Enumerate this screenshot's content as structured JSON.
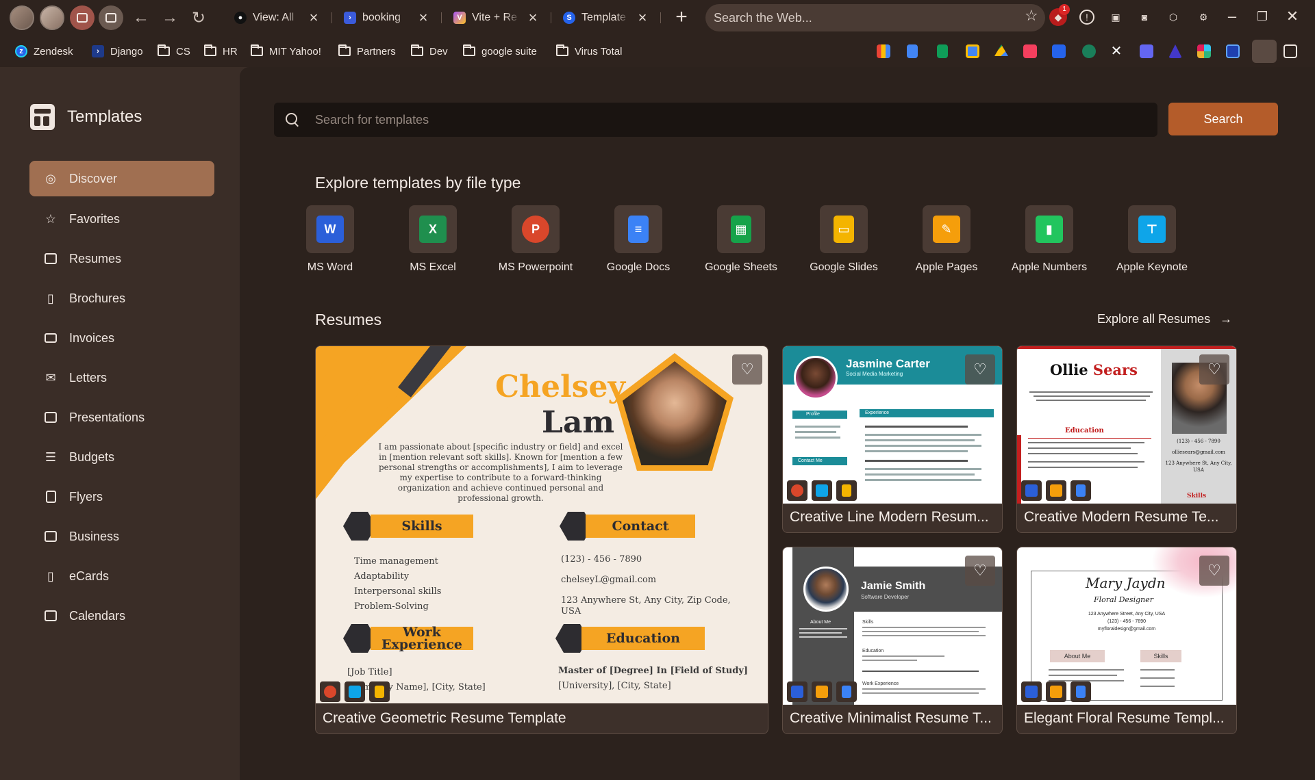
{
  "browser": {
    "tabs": [
      {
        "title": "View: All",
        "fav_color": "#111111",
        "fav_text": "●"
      },
      {
        "title": "booking",
        "fav_color": "#3b5bdb",
        "fav_text": "›"
      },
      {
        "title": "Vite + Re",
        "fav_color": "#a855f7",
        "fav_text": "V"
      },
      {
        "title": "Template",
        "fav_color": "#2563eb",
        "fav_text": "S"
      }
    ],
    "address_placeholder": "Search the Web...",
    "notification_count": "1",
    "bookmarks": [
      {
        "label": "Zendesk",
        "type": "logo",
        "color": "#2563eb"
      },
      {
        "label": "Django",
        "type": "logo",
        "color": "#1e3a8a"
      },
      {
        "label": "CS",
        "type": "folder"
      },
      {
        "label": "HR",
        "type": "folder"
      },
      {
        "label": "MIT Yahoo!",
        "type": "folder"
      },
      {
        "label": "Partners",
        "type": "folder"
      },
      {
        "label": "Dev",
        "type": "folder"
      },
      {
        "label": "google suite",
        "type": "folder"
      },
      {
        "label": "Virus Total",
        "type": "folder"
      }
    ],
    "bookmark_apps": [
      "gmail",
      "docs",
      "sheets",
      "calendar",
      "drive",
      "monday",
      "jira",
      "chatgpt",
      "x",
      "zoom",
      "linear",
      "slack",
      "meet",
      "templates",
      "grid"
    ]
  },
  "sidebar": {
    "title": "Templates",
    "items": [
      {
        "label": "Discover",
        "icon": "compass-icon",
        "active": true
      },
      {
        "label": "Favorites",
        "icon": "star-icon"
      },
      {
        "label": "Resumes",
        "icon": "id-card-icon"
      },
      {
        "label": "Brochures",
        "icon": "book-open-icon"
      },
      {
        "label": "Invoices",
        "icon": "receipt-icon"
      },
      {
        "label": "Letters",
        "icon": "mail-icon"
      },
      {
        "label": "Presentations",
        "icon": "presentation-icon"
      },
      {
        "label": "Budgets",
        "icon": "list-icon"
      },
      {
        "label": "Flyers",
        "icon": "file-icon"
      },
      {
        "label": "Business",
        "icon": "store-icon"
      },
      {
        "label": "eCards",
        "icon": "book-icon"
      },
      {
        "label": "Calendars",
        "icon": "calendar-icon"
      }
    ]
  },
  "search": {
    "placeholder": "Search for templates",
    "button_label": "Search"
  },
  "file_types": {
    "title": "Explore templates by file type",
    "items": [
      {
        "label": "MS Word",
        "color": "#2b5fd9",
        "glyph": "W"
      },
      {
        "label": "MS Excel",
        "color": "#1f8f4e",
        "glyph": "X"
      },
      {
        "label": "MS Powerpoint",
        "color": "#d9472b",
        "glyph": "P"
      },
      {
        "label": "Google Docs",
        "color": "#3b82f6",
        "glyph": "≡"
      },
      {
        "label": "Google Sheets",
        "color": "#16a34a",
        "glyph": "▦"
      },
      {
        "label": "Google Slides",
        "color": "#f4b400",
        "glyph": "▭"
      },
      {
        "label": "Apple Pages",
        "color": "#f59e0b",
        "glyph": "✎"
      },
      {
        "label": "Apple Numbers",
        "color": "#22c55e",
        "glyph": "▮"
      },
      {
        "label": "Apple Keynote",
        "color": "#0ea5e9",
        "glyph": "⊤"
      }
    ]
  },
  "resumes": {
    "title": "Resumes",
    "explore_all": "Explore all Resumes",
    "cards": [
      {
        "title": "Creative Geometric Resume Template"
      },
      {
        "title": "Creative Line Modern Resum..."
      },
      {
        "title": "Creative Modern Resume Te..."
      },
      {
        "title": "Creative Minimalist Resume T..."
      },
      {
        "title": "Elegant Floral Resume Templ..."
      }
    ]
  },
  "previews": {
    "geometric": {
      "first_name": "Chelsey",
      "last_name": "Lam",
      "intro": "I am passionate about [specific industry or field] and excel in [mention relevant soft skills]. Known for [mention a few personal strengths or accomplishments], I aim to leverage my expertise to contribute to a forward-thinking organization and achieve continued personal and professional growth.",
      "skills_heading": "Skills",
      "contact_heading": "Contact",
      "work_heading": "Work Experience",
      "education_heading": "Education",
      "skills": [
        "Time management",
        "Adaptability",
        "Interpersonal skills",
        "Problem-Solving"
      ],
      "phone": "(123) - 456 - 7890",
      "email": "chelseyL@gmail.com",
      "address": "123 Anywhere St, Any City, Zip Code, USA",
      "education_line": "Master of [Degree] In [Field of Study]",
      "education_line2": "[University], [City, State]",
      "work_line": "[Job Title]",
      "work_line2": "[Company Name], [City, State]"
    },
    "line_modern": {
      "name": "Jasmine Carter",
      "role": "Social Media Marketing",
      "profile": "Profile",
      "experience": "Experience",
      "contact": "Contact Me"
    },
    "modern": {
      "first": "Ollie",
      "last": "Sears",
      "education": "Education",
      "skills": "Skills",
      "phone": "(123) - 456 - 7890",
      "email": "olliesears@gmail.com",
      "address": "123 Anywhere St, Any City, USA"
    },
    "minimalist": {
      "name": "Jamie Smith",
      "role": "Software Developer",
      "about": "About Me",
      "skills": "Skills",
      "education": "Education",
      "work": "Work Experience"
    },
    "floral": {
      "name": "Mary Jaydn",
      "role": "Floral Designer",
      "address": "123 Anywhere Street, Any City, USA",
      "phone": "(123) - 456 - 7890",
      "email": "myfloraldesign@gmail.com",
      "about": "About Me",
      "skills": "Skills"
    }
  }
}
